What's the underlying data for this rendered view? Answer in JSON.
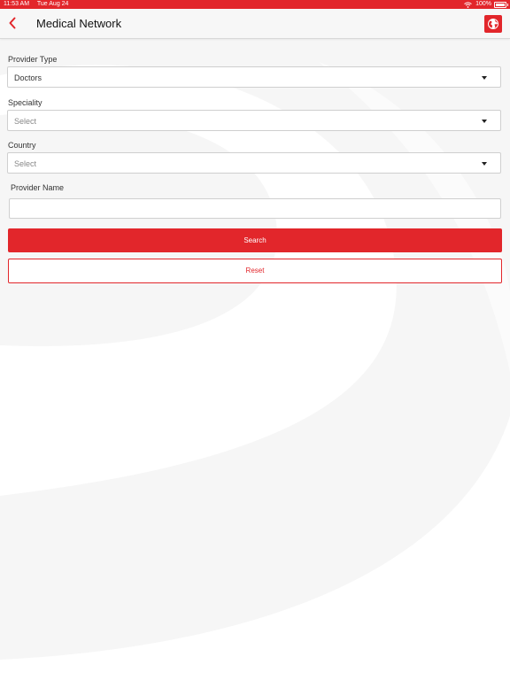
{
  "status_bar": {
    "time": "11:53 AM",
    "date": "Tue Aug 24",
    "battery": "100%",
    "wifi_icon": "wifi-icon",
    "battery_icon": "battery-icon"
  },
  "header": {
    "title": "Medical Network",
    "back_icon": "chevron-left-icon",
    "globe_icon": "globe-icon"
  },
  "form": {
    "provider_type": {
      "label": "Provider Type",
      "value": "Doctors"
    },
    "speciality": {
      "label": "Speciality",
      "placeholder": "Select"
    },
    "country": {
      "label": "Country",
      "placeholder": "Select"
    },
    "provider_name": {
      "label": "Provider Name",
      "value": ""
    },
    "search_label": "Search",
    "reset_label": "Reset"
  },
  "colors": {
    "accent": "#e2262b",
    "background": "#f6f6f6"
  }
}
